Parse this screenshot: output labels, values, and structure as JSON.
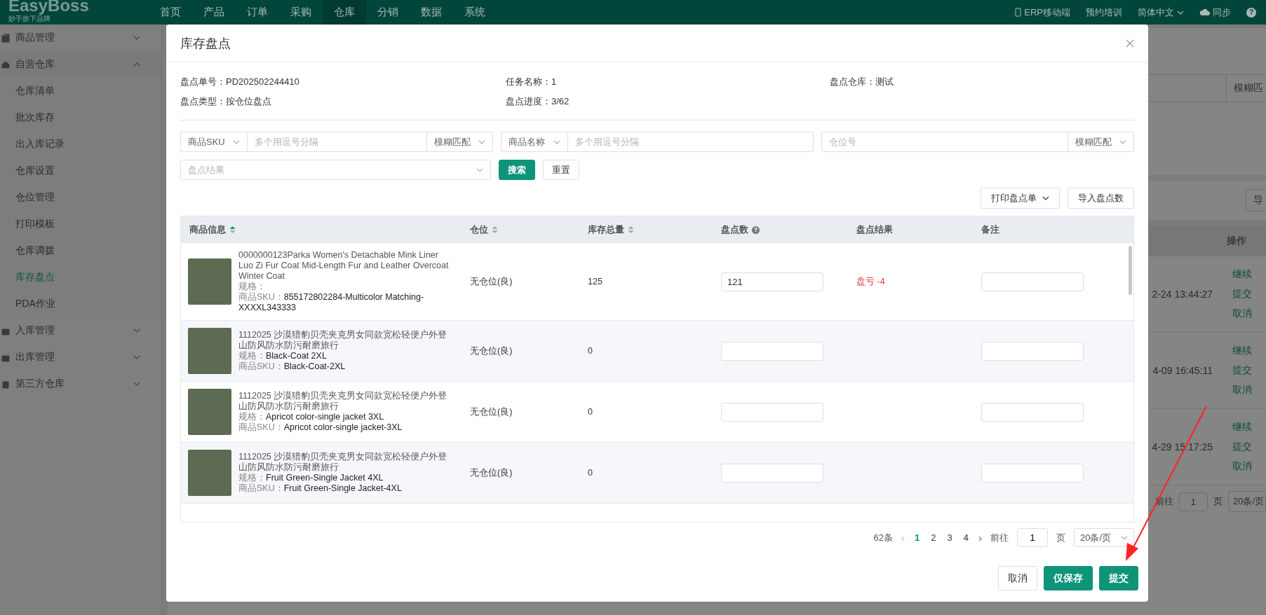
{
  "app": {
    "logo": "EasyBoss",
    "tagline": "妙手旗下品牌"
  },
  "nav": [
    {
      "label": "首页",
      "selected": false
    },
    {
      "label": "产品",
      "selected": false
    },
    {
      "label": "订单",
      "selected": false
    },
    {
      "label": "采购",
      "selected": false
    },
    {
      "label": "仓库",
      "selected": true
    },
    {
      "label": "分销",
      "selected": false
    },
    {
      "label": "数据",
      "selected": false
    },
    {
      "label": "系统",
      "selected": false
    }
  ],
  "nav_right": [
    {
      "kind": "phone",
      "label": "ERP移动端"
    },
    {
      "kind": "plain",
      "label": "预约培训"
    },
    {
      "kind": "lang",
      "label": "简体中文"
    },
    {
      "kind": "cloud",
      "label": "同步"
    },
    {
      "kind": "help",
      "label": "?"
    }
  ],
  "sidebar": [
    {
      "kind": "tag",
      "label": "商品管理",
      "expanded": false
    },
    {
      "kind": "home",
      "label": "自营仓库",
      "expanded": true,
      "children": [
        {
          "label": "仓库清单",
          "selected": false
        },
        {
          "label": "批次库存",
          "selected": false
        },
        {
          "label": "出入库记录",
          "selected": false
        },
        {
          "label": "仓库设置",
          "selected": false
        },
        {
          "label": "仓位管理",
          "selected": false
        },
        {
          "label": "打印模板",
          "selected": false
        },
        {
          "label": "仓库调拨",
          "selected": false
        },
        {
          "label": "库存盘点",
          "selected": true
        },
        {
          "label": "PDA作业",
          "selected": false
        }
      ]
    },
    {
      "kind": "in",
      "label": "入库管理",
      "expanded": false
    },
    {
      "kind": "out",
      "label": "出库管理",
      "expanded": false
    },
    {
      "kind": "box",
      "label": "第三方仓库",
      "expanded": false
    }
  ],
  "background": {
    "filter_text": "模糊匹",
    "export_text": "导",
    "action_header": "操作",
    "rows": [
      {
        "time": "2-24 13:44:27",
        "actions": [
          "继续",
          "提交",
          "取消"
        ]
      },
      {
        "time": "4-09 16:45:11",
        "actions": [
          "继续",
          "提交",
          "取消"
        ]
      },
      {
        "time": "4-29 15:17:25",
        "actions": [
          "继续",
          "提交",
          "取消"
        ]
      }
    ],
    "pagination": {
      "goto": "前往",
      "page": "1",
      "unit": "页",
      "size": "20条/页"
    }
  },
  "dialog": {
    "title": "库存盘点",
    "info": [
      {
        "label": "盘点单号：",
        "value": "PD202502244410"
      },
      {
        "label": "任务名称：",
        "value": "1"
      },
      {
        "label": "盘点仓库：",
        "value": "测试"
      },
      {
        "label": "盘点类型：",
        "value": "按仓位盘点"
      },
      {
        "label": "盘点进度：",
        "value": "3/62"
      }
    ],
    "filters": {
      "sku_select": "商品SKU",
      "sku_placeholder": "多个用逗号分隔",
      "sku_match": "模糊匹配",
      "name_select": "商品名称",
      "name_placeholder": "多个用逗号分隔",
      "location_placeholder": "仓位号",
      "location_match": "模糊匹配",
      "result_placeholder": "盘点结果",
      "search": "搜索",
      "reset": "重置"
    },
    "actions": {
      "print": "打印盘点单",
      "import": "导入盘点数"
    },
    "columns": [
      {
        "label": "商品信息",
        "sortable": true,
        "sorted": true
      },
      {
        "label": "仓位",
        "sortable": true,
        "sorted": false
      },
      {
        "label": "库存总量",
        "sortable": true,
        "sorted": false
      },
      {
        "label": "盘点数",
        "hint": "?",
        "sortable": false
      },
      {
        "label": "盘点结果",
        "sortable": false
      },
      {
        "label": "备注",
        "sortable": false
      }
    ],
    "rows": [
      {
        "title": "0000000123Parka Women's Detachable Mink Liner Luo Zi Fur Coat Mid-Length Fur and Leather Overcoat Winter Coat",
        "spec_label": "规格：",
        "sku_label": "商品SKU：",
        "sku": "855172802284-Multicolor Matching-XXXXL343333",
        "location": "无仓位(良)",
        "total": "125",
        "count": "121",
        "result": "盘亏 -4",
        "loss": true
      },
      {
        "title": "1112025 沙漠猎豹贝壳夹克男女同款宽松轻便户外登山防风防水防污耐磨旅行",
        "spec_label": "规格：",
        "spec": "Black-Coat 2XL",
        "sku_label": "商品SKU：",
        "sku": "Black-Coat-2XL",
        "location": "无仓位(良)",
        "total": "0"
      },
      {
        "title": "1112025 沙漠猎豹贝壳夹克男女同款宽松轻便户外登山防风防水防污耐磨旅行",
        "spec_label": "规格：",
        "spec": "Apricot color-single jacket 3XL",
        "sku_label": "商品SKU：",
        "sku": "Apricot color-single jacket-3XL",
        "location": "无仓位(良)",
        "total": "0"
      },
      {
        "title": "1112025 沙漠猎豹贝壳夹克男女同款宽松轻便户外登山防风防水防污耐磨旅行",
        "spec_label": "规格：",
        "spec": "Fruit Green-Single Jacket 4XL",
        "sku_label": "商品SKU：",
        "sku": "Fruit Green-Single Jacket-4XL",
        "location": "无仓位(良)",
        "total": "0"
      }
    ],
    "pagination": {
      "total": "62条",
      "prev": "‹",
      "pages": [
        {
          "label": "1",
          "selected": true
        },
        {
          "label": "2",
          "selected": false
        },
        {
          "label": "3",
          "selected": false
        },
        {
          "label": "4",
          "selected": false
        }
      ],
      "next": "›",
      "goto": "前往",
      "page": "1",
      "unit": "页",
      "size": "20条/页"
    },
    "footer": {
      "cancel": "取消",
      "save": "仅保存",
      "submit": "提交"
    }
  }
}
